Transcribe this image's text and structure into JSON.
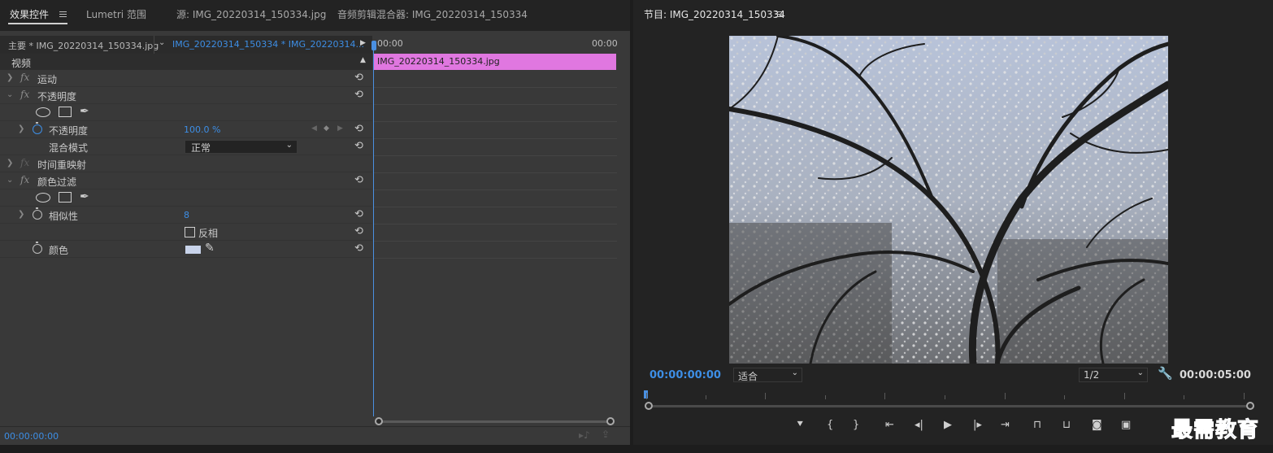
{
  "left_panel": {
    "tabs": [
      {
        "label": "效果控件",
        "active": true
      },
      {
        "label": "Lumetri 范围",
        "active": false
      },
      {
        "label": "源: IMG_20220314_150334.jpg",
        "active": false
      },
      {
        "label": "音频剪辑混合器: IMG_20220314_150334",
        "active": false
      }
    ],
    "clip_selector": {
      "master": "主要 * IMG_20220314_150334.jpg",
      "sequence": "IMG_20220314_150334 * IMG_20220314..."
    },
    "section_video": "视频",
    "effects": [
      {
        "name": "运动",
        "expanded": false
      },
      {
        "name": "不透明度",
        "expanded": true
      },
      {
        "name": "时间重映射",
        "expanded": false
      },
      {
        "name": "颜色过滤",
        "expanded": true
      }
    ],
    "opacity": {
      "label": "不透明度",
      "value": "100.0 %"
    },
    "blend_mode": {
      "label": "混合模式",
      "value": "正常"
    },
    "color_filter": {
      "similarity": {
        "label": "相似性",
        "value": "8"
      },
      "invert": {
        "label": "反相",
        "checked": false
      },
      "color": {
        "label": "颜色",
        "swatch": "#c8d3ea"
      }
    },
    "timeline": {
      "start_time": "00:00",
      "end_time": "00:00",
      "clip_name": "IMG_20220314_150334.jpg",
      "clip_color": "#e077e0"
    },
    "current_time": "00:00:00:00"
  },
  "right_panel": {
    "title": "节目: IMG_20220314_150334",
    "current_time": "00:00:00:00",
    "fit_label": "适合",
    "resolution": "1/2",
    "duration": "00:00:05:00",
    "transport_icons": [
      "marker-icon",
      "mark-in-icon",
      "mark-out-icon",
      "go-to-in-icon",
      "step-back-icon",
      "play-icon",
      "step-forward-icon",
      "go-to-out-icon",
      "lift-icon",
      "extract-icon",
      "export-frame-icon",
      "compare-view-icon"
    ]
  },
  "watermark": "最需教育",
  "colors": {
    "accent_blue": "#3d8ee5",
    "panel_bg": "#232323",
    "ec_bg": "#393939"
  }
}
